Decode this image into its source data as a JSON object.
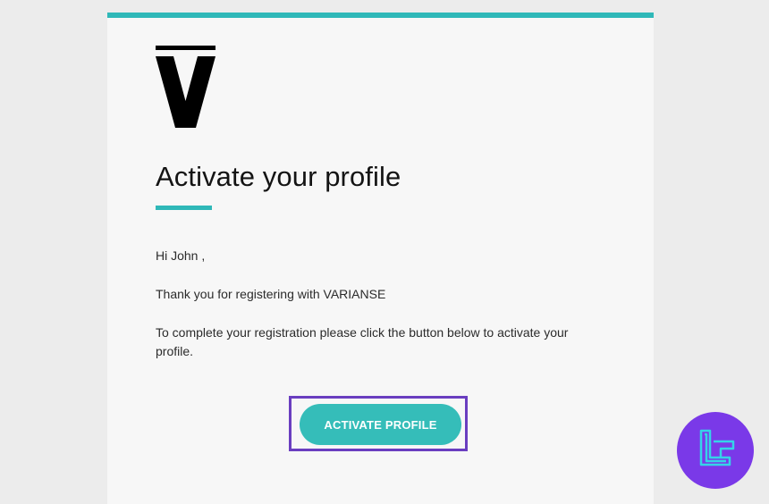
{
  "email": {
    "title": "Activate your profile",
    "greeting": "Hi John ,",
    "thanks": "Thank you for registering with VARIANSE",
    "instructions": "To complete your registration please click the button below to activate your profile.",
    "button_label": "ACTIVATE PROFILE"
  },
  "colors": {
    "accent": "#2fb8b8",
    "button": "#35bdb9",
    "highlight": "#6a3ec0",
    "watermark": "#7a39e8"
  },
  "icons": {
    "logo": "varianse-v-logo-icon",
    "watermark": "tradingfinder-logo-icon"
  }
}
